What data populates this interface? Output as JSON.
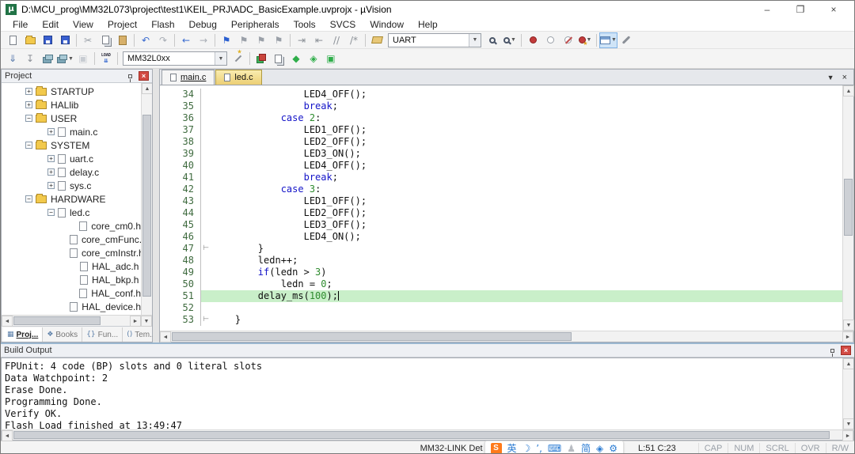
{
  "colors": {
    "keyword": "#1414c8",
    "number": "#2e8b2e",
    "line_highlight": "#c9efc9",
    "active_tab": "#eccf74",
    "panel_header_bg": "#eef0f4",
    "breakpoint_red": "#c23b3b",
    "folder_yellow": "#f2c94c",
    "close_red": "#d24a43",
    "ime_blue": "#2b7cd3",
    "ime_orange": "#ff7a1a"
  },
  "glyphs": {
    "minimize": "–",
    "restore": "❐",
    "close": "×",
    "dropdown": "▼",
    "up": "▲",
    "down": "▼",
    "left": "◄",
    "right": "►",
    "fold_end": "⊢",
    "panel_close": "×"
  },
  "window": {
    "title": "D:\\MCU_prog\\MM32L073\\project\\test1\\KEIL_PRJ\\ADC_BasicExample.uvprojx - µVision",
    "app_icon_letter": "µ"
  },
  "menu": [
    "File",
    "Edit",
    "View",
    "Project",
    "Flash",
    "Debug",
    "Peripherals",
    "Tools",
    "SVCS",
    "Window",
    "Help"
  ],
  "toolbars": {
    "row1": [
      {
        "t": "btn",
        "name": "new-file-button",
        "icon": "page"
      },
      {
        "t": "btn",
        "name": "open-file-button",
        "icon": "folder"
      },
      {
        "t": "btn",
        "name": "save-button",
        "icon": "floppy"
      },
      {
        "t": "btn",
        "name": "save-all-button",
        "icon": "floppy"
      },
      {
        "t": "sep"
      },
      {
        "t": "btn",
        "name": "cut-button",
        "icon": "glyph",
        "g": "✂",
        "c": "#9aa0a8"
      },
      {
        "t": "btn",
        "name": "copy-button",
        "icon": "pages"
      },
      {
        "t": "btn",
        "name": "paste-button",
        "icon": "clip"
      },
      {
        "t": "sep"
      },
      {
        "t": "btn",
        "name": "undo-button",
        "icon": "glyph",
        "g": "↶",
        "c": "#3a6bd0"
      },
      {
        "t": "btn",
        "name": "redo-button",
        "icon": "glyph",
        "g": "↷",
        "c": "#a8adb5"
      },
      {
        "t": "sep"
      },
      {
        "t": "btn",
        "name": "navigate-back-button",
        "icon": "glyph",
        "g": "←",
        "c": "#3a6bd0"
      },
      {
        "t": "btn",
        "name": "navigate-forward-button",
        "icon": "glyph",
        "g": "→",
        "c": "#a8adb5"
      },
      {
        "t": "sep"
      },
      {
        "t": "btn",
        "name": "toggle-bookmark-button",
        "icon": "glyph",
        "g": "⚑",
        "c": "#2a5fd0"
      },
      {
        "t": "btn",
        "name": "prev-bookmark-button",
        "icon": "glyph",
        "g": "⚑",
        "c": "#9aa0a8"
      },
      {
        "t": "btn",
        "name": "next-bookmark-button",
        "icon": "glyph",
        "g": "⚑",
        "c": "#9aa0a8"
      },
      {
        "t": "btn",
        "name": "clear-bookmarks-button",
        "icon": "glyph",
        "g": "⚑",
        "c": "#9aa0a8"
      },
      {
        "t": "sep"
      },
      {
        "t": "btn",
        "name": "indent-button",
        "icon": "glyph",
        "g": "⇥",
        "c": "#8b9097"
      },
      {
        "t": "btn",
        "name": "outdent-button",
        "icon": "glyph",
        "g": "⇤",
        "c": "#8b9097"
      },
      {
        "t": "btn",
        "name": "comment-button",
        "icon": "glyph",
        "g": "//",
        "c": "#8b9097"
      },
      {
        "t": "btn",
        "name": "uncomment-button",
        "icon": "glyph",
        "g": "/*",
        "c": "#8b9097"
      },
      {
        "t": "sep"
      },
      {
        "t": "btn",
        "name": "find-in-files-button",
        "icon": "book"
      },
      {
        "t": "combo",
        "name": "search-combo",
        "v": "UART",
        "w": 118
      },
      {
        "t": "btn",
        "name": "find-button",
        "icon": "mag"
      },
      {
        "t": "btn",
        "name": "incremental-find-button",
        "icon": "mag",
        "dd": true
      },
      {
        "t": "sep"
      },
      {
        "t": "btn",
        "name": "insert-breakpoint-button",
        "icon": "dot"
      },
      {
        "t": "btn",
        "name": "enable-breakpoint-button",
        "icon": "dot",
        "hollow": true
      },
      {
        "t": "btn",
        "name": "disable-all-breakpoints-button",
        "icon": "dot",
        "hollow": true,
        "slash": true
      },
      {
        "t": "btn",
        "name": "kill-all-breakpoints-button",
        "icon": "dot",
        "star": true,
        "dd": true
      },
      {
        "t": "sep"
      },
      {
        "t": "btn",
        "name": "debug-windows-button",
        "icon": "win",
        "dd": true,
        "hilite": true
      },
      {
        "t": "btn",
        "name": "configuration-button",
        "icon": "wrench"
      }
    ],
    "row2": [
      {
        "t": "btn",
        "name": "translate-button",
        "icon": "glyph",
        "g": "⇓",
        "c": "#5577aa"
      },
      {
        "t": "btn",
        "name": "build-button",
        "icon": "glyph",
        "g": "↧",
        "c": "#8b9097"
      },
      {
        "t": "btn",
        "name": "rebuild-button",
        "icon": "bricks"
      },
      {
        "t": "btn",
        "name": "batch-build-button",
        "icon": "bricks",
        "dd": true
      },
      {
        "t": "btn",
        "name": "stop-build-button",
        "icon": "glyph",
        "g": "▣",
        "c": "#c8ccd2"
      },
      {
        "t": "sep"
      },
      {
        "t": "btn",
        "name": "flash-download-button",
        "icon": "load",
        "label": "LOAD"
      },
      {
        "t": "sep"
      },
      {
        "t": "combo",
        "name": "target-combo",
        "v": "MM32L0xx",
        "w": 132
      },
      {
        "t": "btn",
        "name": "options-for-target-button",
        "icon": "wand"
      },
      {
        "t": "sep"
      },
      {
        "t": "btn",
        "name": "manage-rte-button",
        "icon": "rte"
      },
      {
        "t": "btn",
        "name": "manage-project-items-button",
        "icon": "pages"
      },
      {
        "t": "btn",
        "name": "file-extensions-button",
        "icon": "glyph",
        "g": "◆",
        "c": "#2fae4a"
      },
      {
        "t": "btn",
        "name": "software-packs-button",
        "icon": "glyph",
        "g": "◈",
        "c": "#2fae4a"
      },
      {
        "t": "btn",
        "name": "pack-installer-button",
        "icon": "glyph",
        "g": "▣",
        "c": "#2fae4a"
      }
    ]
  },
  "project_panel": {
    "title": "Project",
    "tree": [
      {
        "label": "STARTUP",
        "depth": 1,
        "exp": "+",
        "icon": "folder"
      },
      {
        "label": "HALlib",
        "depth": 1,
        "exp": "+",
        "icon": "folder"
      },
      {
        "label": "USER",
        "depth": 1,
        "exp": "−",
        "icon": "folder"
      },
      {
        "label": "main.c",
        "depth": 2,
        "exp": "+",
        "icon": "file"
      },
      {
        "label": "SYSTEM",
        "depth": 1,
        "exp": "−",
        "icon": "folder"
      },
      {
        "label": "uart.c",
        "depth": 2,
        "exp": "+",
        "icon": "file"
      },
      {
        "label": "delay.c",
        "depth": 2,
        "exp": "+",
        "icon": "file"
      },
      {
        "label": "sys.c",
        "depth": 2,
        "exp": "+",
        "icon": "file"
      },
      {
        "label": "HARDWARE",
        "depth": 1,
        "exp": "−",
        "icon": "folder"
      },
      {
        "label": "led.c",
        "depth": 2,
        "exp": "−",
        "icon": "file"
      },
      {
        "label": "core_cm0.h",
        "depth": 3,
        "icon": "file"
      },
      {
        "label": "core_cmFunc.h",
        "depth": 3,
        "icon": "file"
      },
      {
        "label": "core_cmInstr.h",
        "depth": 3,
        "icon": "file"
      },
      {
        "label": "HAL_adc.h",
        "depth": 3,
        "icon": "file"
      },
      {
        "label": "HAL_bkp.h",
        "depth": 3,
        "icon": "file"
      },
      {
        "label": "HAL_conf.h",
        "depth": 3,
        "icon": "file"
      },
      {
        "label": "HAL_device.h",
        "depth": 3,
        "icon": "file"
      }
    ],
    "tabs": [
      {
        "label": "Proj...",
        "icon": "▦",
        "active": true
      },
      {
        "label": "Books",
        "icon": "❖",
        "active": false
      },
      {
        "label": "Fun...",
        "icon": "{}",
        "active": false
      },
      {
        "label": "Tem...",
        "icon": "()",
        "active": false
      }
    ]
  },
  "editor": {
    "tabs": [
      {
        "label": "main.c",
        "active": false
      },
      {
        "label": "led.c",
        "active": true
      }
    ],
    "code": [
      {
        "n": 34,
        "t": "                LED4_OFF();"
      },
      {
        "n": 35,
        "t": "                break;"
      },
      {
        "n": 36,
        "t": "            case 2:"
      },
      {
        "n": 37,
        "t": "                LED1_OFF();"
      },
      {
        "n": 38,
        "t": "                LED2_OFF();"
      },
      {
        "n": 39,
        "t": "                LED3_ON();"
      },
      {
        "n": 40,
        "t": "                LED4_OFF();"
      },
      {
        "n": 41,
        "t": "                break;"
      },
      {
        "n": 42,
        "t": "            case 3:"
      },
      {
        "n": 43,
        "t": "                LED1_OFF();"
      },
      {
        "n": 44,
        "t": "                LED2_OFF();"
      },
      {
        "n": 45,
        "t": "                LED3_OFF();"
      },
      {
        "n": 46,
        "t": "                LED4_ON();"
      },
      {
        "n": 47,
        "t": "        }",
        "fold": true
      },
      {
        "n": 48,
        "t": "        ledn++;"
      },
      {
        "n": 49,
        "t": "        if(ledn > 3)"
      },
      {
        "n": 50,
        "t": "            ledn = 0;"
      },
      {
        "n": 51,
        "t": "        delay_ms(100);",
        "hl": true,
        "caret": true
      },
      {
        "n": 52,
        "t": ""
      },
      {
        "n": 53,
        "t": "    }",
        "fold": true
      }
    ]
  },
  "build_output": {
    "title": "Build Output",
    "lines": [
      "FPUnit: 4 code (BP) slots and 0 literal slots",
      "Data Watchpoint: 2",
      "Erase Done.",
      "Programming Done.",
      "Verify OK.",
      "Flash Load finished at 13:49:47"
    ]
  },
  "status_bar": {
    "debugger": "MM32-LINK Det",
    "position": "L:51 C:23",
    "indicators": [
      "CAP",
      "NUM",
      "SCRL",
      "OVR",
      "R/W"
    ],
    "ime": [
      {
        "g": "S",
        "logo": true
      },
      {
        "g": "英"
      },
      {
        "g": "☽"
      },
      {
        "g": "’,"
      },
      {
        "g": "⌨"
      },
      {
        "g": "♟",
        "muted": true
      },
      {
        "g": "简"
      },
      {
        "g": "◈"
      },
      {
        "g": "⚙"
      }
    ]
  }
}
